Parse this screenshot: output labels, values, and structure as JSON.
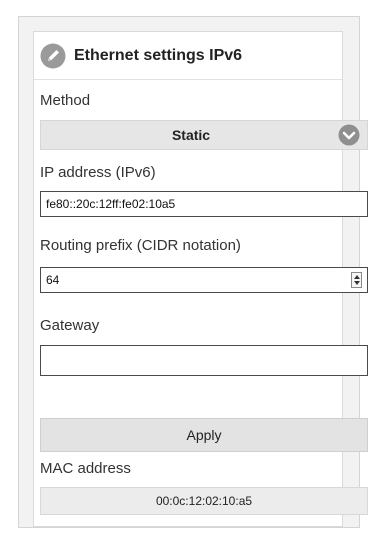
{
  "panel": {
    "title": "Ethernet settings IPv6",
    "header_icon": "pencil-icon"
  },
  "method": {
    "label": "Method",
    "selected": "Static",
    "dropdown_icon": "chevron-down-icon"
  },
  "ip_address": {
    "label": "IP address (IPv6)",
    "value": "fe80::20c:12ff:fe02:10a5"
  },
  "routing_prefix": {
    "label": "Routing prefix (CIDR notation)",
    "value": "64"
  },
  "gateway": {
    "label": "Gateway",
    "value": ""
  },
  "apply_button": {
    "label": "Apply"
  },
  "mac_address": {
    "label": "MAC address",
    "value": "00:0c:12:02:10:a5"
  },
  "colors": {
    "icon_fill": "#9a9a9a",
    "button_bg": "#e3e3e3",
    "select_bg": "#e6e6e6"
  }
}
